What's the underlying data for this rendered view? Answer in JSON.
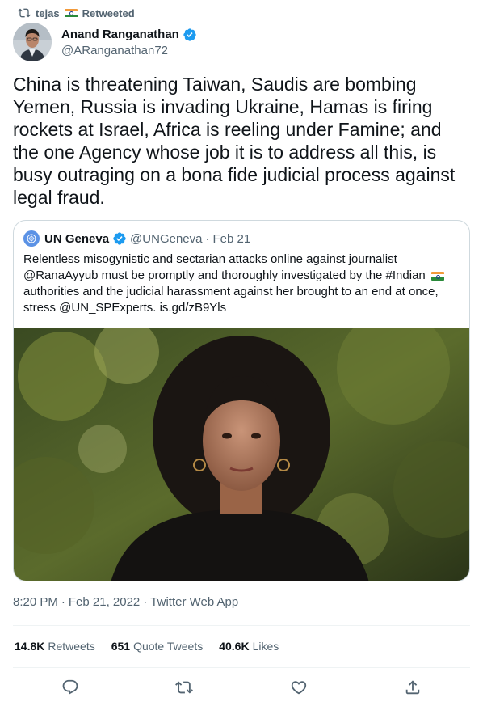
{
  "retweet": {
    "user": "tejas",
    "label": "Retweeted"
  },
  "author": {
    "name": "Anand Ranganathan",
    "handle": "@ARanganathan72",
    "verified": true
  },
  "tweet": {
    "text": "China is threatening Taiwan, Saudis are bombing Yemen, Russia is invading Ukraine, Hamas is firing rockets at Israel, Africa is reeling under Famine; and the one Agency whose job it is to address all this, is busy outraging on a bona fide judicial process against legal fraud."
  },
  "quote": {
    "name": "UN Geneva",
    "handle": "@UNGeneva",
    "separator": "·",
    "date": "Feb 21",
    "text_part1": "Relentless misogynistic and sectarian attacks online against journalist @RanaAyyub  must be promptly and thoroughly investigated by the #Indian",
    "text_part2": "authorities and the judicial harassment against her brought to an end at once, stress @UN_SPExperts. is.gd/zB9Yls"
  },
  "meta": {
    "time": "8:20 PM",
    "separator1": "·",
    "date": "Feb 21, 2022",
    "separator2": "·",
    "source": "Twitter Web App"
  },
  "stats": {
    "retweets_count": "14.8K",
    "retweets_label": "Retweets",
    "quotes_count": "651",
    "quotes_label": "Quote Tweets",
    "likes_count": "40.6K",
    "likes_label": "Likes"
  },
  "colors": {
    "text": "#0f1419",
    "secondary": "#536471",
    "verified": "#1d9bf0",
    "border": "#cfd9de"
  },
  "icons": {
    "retweet": "retweet-icon",
    "reply": "reply-icon",
    "like": "heart-icon",
    "share": "share-icon",
    "verified": "verified-badge-icon"
  }
}
